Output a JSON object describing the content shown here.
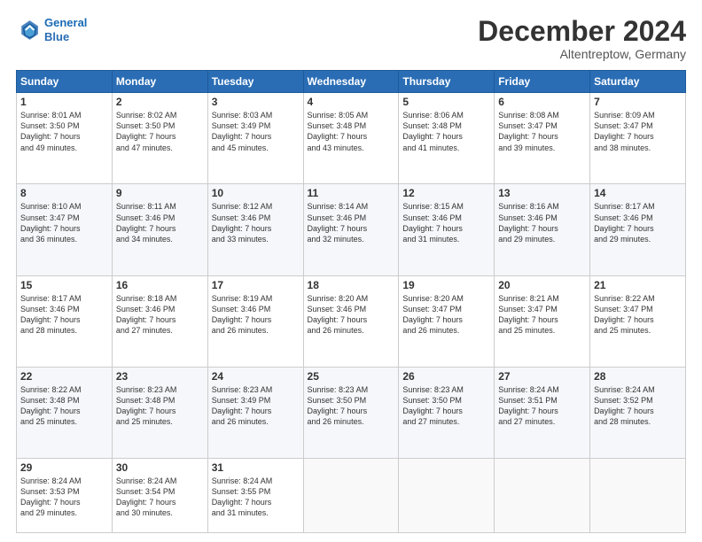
{
  "logo": {
    "line1": "General",
    "line2": "Blue"
  },
  "title": "December 2024",
  "subtitle": "Altentreptow, Germany",
  "days_header": [
    "Sunday",
    "Monday",
    "Tuesday",
    "Wednesday",
    "Thursday",
    "Friday",
    "Saturday"
  ],
  "weeks": [
    [
      {
        "day": "1",
        "lines": [
          "Sunrise: 8:01 AM",
          "Sunset: 3:50 PM",
          "Daylight: 7 hours",
          "and 49 minutes."
        ]
      },
      {
        "day": "2",
        "lines": [
          "Sunrise: 8:02 AM",
          "Sunset: 3:50 PM",
          "Daylight: 7 hours",
          "and 47 minutes."
        ]
      },
      {
        "day": "3",
        "lines": [
          "Sunrise: 8:03 AM",
          "Sunset: 3:49 PM",
          "Daylight: 7 hours",
          "and 45 minutes."
        ]
      },
      {
        "day": "4",
        "lines": [
          "Sunrise: 8:05 AM",
          "Sunset: 3:48 PM",
          "Daylight: 7 hours",
          "and 43 minutes."
        ]
      },
      {
        "day": "5",
        "lines": [
          "Sunrise: 8:06 AM",
          "Sunset: 3:48 PM",
          "Daylight: 7 hours",
          "and 41 minutes."
        ]
      },
      {
        "day": "6",
        "lines": [
          "Sunrise: 8:08 AM",
          "Sunset: 3:47 PM",
          "Daylight: 7 hours",
          "and 39 minutes."
        ]
      },
      {
        "day": "7",
        "lines": [
          "Sunrise: 8:09 AM",
          "Sunset: 3:47 PM",
          "Daylight: 7 hours",
          "and 38 minutes."
        ]
      }
    ],
    [
      {
        "day": "8",
        "lines": [
          "Sunrise: 8:10 AM",
          "Sunset: 3:47 PM",
          "Daylight: 7 hours",
          "and 36 minutes."
        ]
      },
      {
        "day": "9",
        "lines": [
          "Sunrise: 8:11 AM",
          "Sunset: 3:46 PM",
          "Daylight: 7 hours",
          "and 34 minutes."
        ]
      },
      {
        "day": "10",
        "lines": [
          "Sunrise: 8:12 AM",
          "Sunset: 3:46 PM",
          "Daylight: 7 hours",
          "and 33 minutes."
        ]
      },
      {
        "day": "11",
        "lines": [
          "Sunrise: 8:14 AM",
          "Sunset: 3:46 PM",
          "Daylight: 7 hours",
          "and 32 minutes."
        ]
      },
      {
        "day": "12",
        "lines": [
          "Sunrise: 8:15 AM",
          "Sunset: 3:46 PM",
          "Daylight: 7 hours",
          "and 31 minutes."
        ]
      },
      {
        "day": "13",
        "lines": [
          "Sunrise: 8:16 AM",
          "Sunset: 3:46 PM",
          "Daylight: 7 hours",
          "and 29 minutes."
        ]
      },
      {
        "day": "14",
        "lines": [
          "Sunrise: 8:17 AM",
          "Sunset: 3:46 PM",
          "Daylight: 7 hours",
          "and 29 minutes."
        ]
      }
    ],
    [
      {
        "day": "15",
        "lines": [
          "Sunrise: 8:17 AM",
          "Sunset: 3:46 PM",
          "Daylight: 7 hours",
          "and 28 minutes."
        ]
      },
      {
        "day": "16",
        "lines": [
          "Sunrise: 8:18 AM",
          "Sunset: 3:46 PM",
          "Daylight: 7 hours",
          "and 27 minutes."
        ]
      },
      {
        "day": "17",
        "lines": [
          "Sunrise: 8:19 AM",
          "Sunset: 3:46 PM",
          "Daylight: 7 hours",
          "and 26 minutes."
        ]
      },
      {
        "day": "18",
        "lines": [
          "Sunrise: 8:20 AM",
          "Sunset: 3:46 PM",
          "Daylight: 7 hours",
          "and 26 minutes."
        ]
      },
      {
        "day": "19",
        "lines": [
          "Sunrise: 8:20 AM",
          "Sunset: 3:47 PM",
          "Daylight: 7 hours",
          "and 26 minutes."
        ]
      },
      {
        "day": "20",
        "lines": [
          "Sunrise: 8:21 AM",
          "Sunset: 3:47 PM",
          "Daylight: 7 hours",
          "and 25 minutes."
        ]
      },
      {
        "day": "21",
        "lines": [
          "Sunrise: 8:22 AM",
          "Sunset: 3:47 PM",
          "Daylight: 7 hours",
          "and 25 minutes."
        ]
      }
    ],
    [
      {
        "day": "22",
        "lines": [
          "Sunrise: 8:22 AM",
          "Sunset: 3:48 PM",
          "Daylight: 7 hours",
          "and 25 minutes."
        ]
      },
      {
        "day": "23",
        "lines": [
          "Sunrise: 8:23 AM",
          "Sunset: 3:48 PM",
          "Daylight: 7 hours",
          "and 25 minutes."
        ]
      },
      {
        "day": "24",
        "lines": [
          "Sunrise: 8:23 AM",
          "Sunset: 3:49 PM",
          "Daylight: 7 hours",
          "and 26 minutes."
        ]
      },
      {
        "day": "25",
        "lines": [
          "Sunrise: 8:23 AM",
          "Sunset: 3:50 PM",
          "Daylight: 7 hours",
          "and 26 minutes."
        ]
      },
      {
        "day": "26",
        "lines": [
          "Sunrise: 8:23 AM",
          "Sunset: 3:50 PM",
          "Daylight: 7 hours",
          "and 27 minutes."
        ]
      },
      {
        "day": "27",
        "lines": [
          "Sunrise: 8:24 AM",
          "Sunset: 3:51 PM",
          "Daylight: 7 hours",
          "and 27 minutes."
        ]
      },
      {
        "day": "28",
        "lines": [
          "Sunrise: 8:24 AM",
          "Sunset: 3:52 PM",
          "Daylight: 7 hours",
          "and 28 minutes."
        ]
      }
    ],
    [
      {
        "day": "29",
        "lines": [
          "Sunrise: 8:24 AM",
          "Sunset: 3:53 PM",
          "Daylight: 7 hours",
          "and 29 minutes."
        ]
      },
      {
        "day": "30",
        "lines": [
          "Sunrise: 8:24 AM",
          "Sunset: 3:54 PM",
          "Daylight: 7 hours",
          "and 30 minutes."
        ]
      },
      {
        "day": "31",
        "lines": [
          "Sunrise: 8:24 AM",
          "Sunset: 3:55 PM",
          "Daylight: 7 hours",
          "and 31 minutes."
        ]
      },
      null,
      null,
      null,
      null
    ]
  ]
}
